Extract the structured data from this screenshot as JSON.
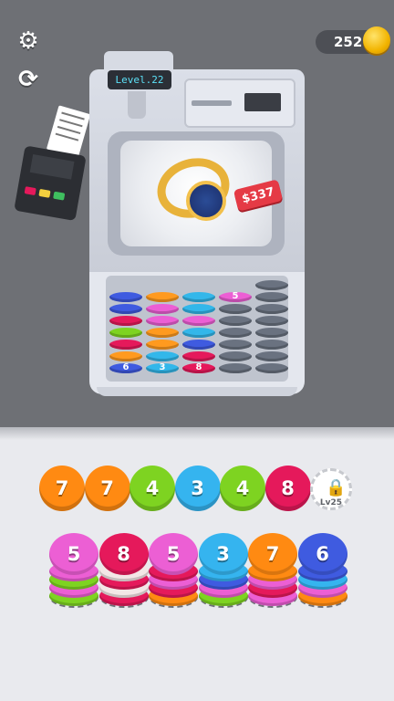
{
  "header": {
    "settings_icon": "gear-icon",
    "restart_icon": "restart-icon",
    "coins": "252",
    "coin_icon": "coin-icon"
  },
  "machine": {
    "level": "Level.22",
    "price_tag": "$337",
    "prize": "watch",
    "columns": [
      {
        "label": "6",
        "colors": [
          "#3f5be0",
          "#ff9a1f",
          "#e5195b",
          "#7ed321",
          "#e5195b",
          "#3f5be0",
          "#3f5be0"
        ]
      },
      {
        "label": "3",
        "colors": [
          "#33b7ea",
          "#33b7ea",
          "#ff9a1f",
          "#ff9a1f",
          "#ec5fd4",
          "#ec5fd4",
          "#ff9a1f"
        ]
      },
      {
        "label": "8",
        "colors": [
          "#e5195b",
          "#e5195b",
          "#3f5be0",
          "#33b7ea",
          "#ec5fd4",
          "#33b7ea",
          "#33b7ea"
        ]
      },
      {
        "label": "5",
        "colors": [
          "#6a7280",
          "#6a7280",
          "#6a7280",
          "#6a7280",
          "#6a7280",
          "#6a7280",
          "#ec5fd4"
        ]
      },
      {
        "label": "",
        "colors": [
          "#6a7280",
          "#6a7280",
          "#6a7280",
          "#6a7280",
          "#6a7280",
          "#6a7280",
          "#6a7280",
          "#6a7280"
        ]
      }
    ]
  },
  "queue": [
    {
      "value": "7",
      "color": "#ff8a12"
    },
    {
      "value": "7",
      "color": "#ff8a12"
    },
    {
      "value": "4",
      "color": "#7ed321"
    },
    {
      "value": "3",
      "color": "#35b4ef"
    },
    {
      "value": "4",
      "color": "#7ed321"
    },
    {
      "value": "8",
      "color": "#e5195b"
    }
  ],
  "lock_slot": {
    "label": "Lv25",
    "icon": "lock-icon"
  },
  "stacks": [
    {
      "value": "5",
      "top": "#ec5fd4",
      "layers": [
        "#7ed321",
        "#ec5fd4",
        "#7ed321",
        "#ec5fd4"
      ]
    },
    {
      "value": "8",
      "top": "#e5195b",
      "layers": [
        "#e5195b",
        "#f3e6e6",
        "#e5195b",
        "#f3e6e6"
      ]
    },
    {
      "value": "5",
      "top": "#ec5fd4",
      "layers": [
        "#ff8a12",
        "#e5195b",
        "#ec5fd4",
        "#e5195b"
      ]
    },
    {
      "value": "3",
      "top": "#35b4ef",
      "layers": [
        "#7ed321",
        "#ec5fd4",
        "#3f5be0",
        "#35b4ef"
      ]
    },
    {
      "value": "7",
      "top": "#ff8a12",
      "layers": [
        "#ec5fd4",
        "#e5195b",
        "#ec5fd4",
        "#ff8a12"
      ]
    },
    {
      "value": "6",
      "top": "#3f5be0",
      "layers": [
        "#ff8a12",
        "#ec5fd4",
        "#35b4ef",
        "#3f5be0"
      ]
    }
  ]
}
